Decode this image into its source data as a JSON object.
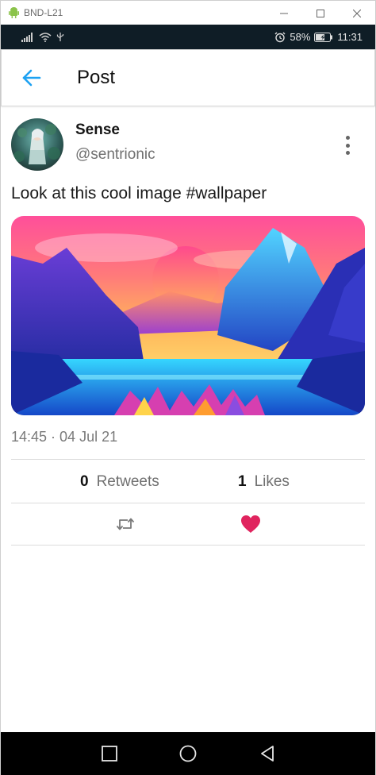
{
  "window": {
    "title": "BND-L21",
    "icon": "android-icon",
    "controls": [
      "minimize-icon",
      "maximize-icon",
      "close-icon"
    ]
  },
  "status_bar": {
    "left_icons": [
      "signal-icon",
      "wifi-icon",
      "usb-icon"
    ],
    "alarm_icon": "alarm-icon",
    "battery_percent": "58%",
    "battery_icon": "battery-charging-icon",
    "time": "11:31"
  },
  "app_bar": {
    "back_icon": "arrow-back-icon",
    "title": "Post"
  },
  "post": {
    "user": {
      "name": "Sense",
      "handle": "@sentrionic"
    },
    "text": "Look at this cool image #wallpaper",
    "timestamp": "14:45 · 04 Jul 21",
    "stats": {
      "retweets_count": "0",
      "retweets_label": "Retweets",
      "likes_count": "1",
      "likes_label": "Likes"
    },
    "actions": {
      "retweet_icon": "retweet-icon",
      "like_icon": "heart-icon",
      "liked": true
    }
  },
  "nav_bar": [
    "square-recents-icon",
    "circle-home-icon",
    "triangle-back-icon"
  ],
  "colors": {
    "accent": "#1da1f2",
    "like": "#e0245e",
    "status_bar_bg": "#0f1d26"
  }
}
